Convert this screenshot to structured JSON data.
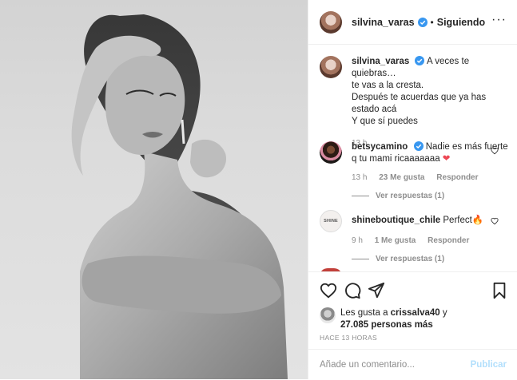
{
  "post": {
    "author": "silvina_varas",
    "follow_status": "Siguiendo",
    "caption_lines": [
      "A veces te quiebras…",
      "te vas a la cresta.",
      "Después te acuerdas que ya has",
      "estado acá",
      "Y que sí puedes"
    ],
    "caption_time": "13 h"
  },
  "comments": [
    {
      "user": "betsycamino",
      "verified": true,
      "text": "Nadie es más fuerte q tu mami ricaaaaaaa",
      "emoji": "❤",
      "time": "13 h",
      "likes": "23 Me gusta",
      "reply": "Responder",
      "replies": "Ver respuestas (1)"
    },
    {
      "user": "shineboutique_chile",
      "verified": false,
      "text": "Perfect",
      "emoji": "🔥",
      "avatar_text": "SHINE",
      "time": "9 h",
      "likes": "1 Me gusta",
      "reply": "Responder",
      "replies": "Ver respuestas (1)"
    }
  ],
  "likes": {
    "prefix": "Les gusta a ",
    "user": "crissalva40",
    "mid": " y",
    "count": "27.085 personas más"
  },
  "timestamp": "HACE 13 HORAS",
  "composer": {
    "placeholder": "Añade un comentario...",
    "publish": "Publicar"
  },
  "colors": {
    "text": "#262626",
    "muted": "#8e8e8e",
    "verified": "#3897f0",
    "publish_disabled": "#b2dffc",
    "heart": "#ed4956"
  },
  "icons": [
    "heart-icon",
    "comment-icon",
    "share-icon",
    "bookmark-icon",
    "more-options-icon",
    "verified-badge-icon"
  ]
}
